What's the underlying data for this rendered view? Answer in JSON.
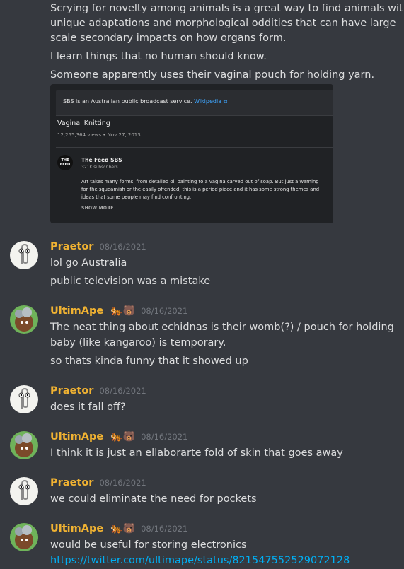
{
  "intro": {
    "text_line1": "Scrying for novelty among animals is a great way to find animals with",
    "text_line2": "unique adaptations and morphological oddities that can have large",
    "text_line3": "scale secondary impacts on how organs form.",
    "line4": "I learn things that no human should know.",
    "line5": "Someone apparently uses their vaginal pouch for holding yarn."
  },
  "embed": {
    "notice": "SBS is an Australian public broadcast service.",
    "notice_link": "Wikipedia ⧉",
    "video_title": "Vaginal Knitting",
    "video_meta": "12,255,364 views • Nov 27, 2013",
    "channel_icon_text": "THE FEED",
    "channel_name": "The Feed SBS",
    "channel_subs": "321K subscribers",
    "description": "Art takes many forms, from detailed oil painting to a vagina carved out of soap. But just a warning for the squeamish or the easily offended, this is a period piece and it has some strong themes and ideas that some people may find confronting.",
    "show_more": "SHOW MORE"
  },
  "messages": [
    {
      "author": "Praetor",
      "time": "08/16/2021",
      "lines": [
        "lol go Australia",
        "public television was a mistake"
      ]
    },
    {
      "author": "UltimApe",
      "emojis": "🐅🐻",
      "time": "08/16/2021",
      "lines": [
        "The neat thing about echidnas is their womb(?) / pouch for holding",
        "baby (like kangaroo) is temporary.",
        "so thats kinda funny that it showed up"
      ]
    },
    {
      "author": "Praetor",
      "time": "08/16/2021",
      "lines": [
        "does it fall off?"
      ]
    },
    {
      "author": "UltimApe",
      "emojis": "🐅🐻",
      "time": "08/16/2021",
      "lines": [
        "I think it is just an ellaborarte fold of skin that goes away"
      ]
    },
    {
      "author": "Praetor",
      "time": "08/16/2021",
      "lines": [
        "we could eliminate the need for pockets"
      ]
    },
    {
      "author": "UltimApe",
      "emojis": "🐅🐻",
      "time": "08/16/2021",
      "lines": [
        "would be useful for storing electronics",
        "https://twitter.com/ultimape/status/821547552529072128"
      ]
    }
  ],
  "colors": {
    "background": "#36393f",
    "username": "#f0b232",
    "link": "#00aff4",
    "timestamp": "#72767d"
  }
}
